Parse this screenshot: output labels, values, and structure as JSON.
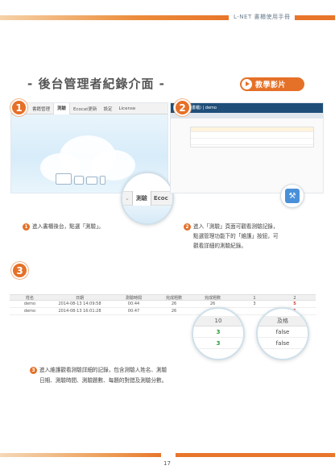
{
  "header": {
    "manual_title": "L-NET 書櫃使用手冊"
  },
  "section": {
    "title": "- 後台管理者紀錄介面 -"
  },
  "video_button": {
    "label": "教學影片"
  },
  "shot1": {
    "badge": "1",
    "nav_items": [
      "書籍管理",
      "測驗",
      "Ecocat更新",
      "設定",
      "License"
    ],
    "zoom_active": "測驗",
    "zoom_next": "Ecoc"
  },
  "shot2": {
    "badge": "2",
    "app_bar": "(書櫃) | demo"
  },
  "captions": {
    "c1_num": "1",
    "c1_text": "進入書櫃後台，點選「測驗」。",
    "c2_num": "2",
    "c2_line1": "進入「測驗」頁面可觀看測驗記錄，",
    "c2_line2": "點選管理功能下的「維護」按鈕，可",
    "c2_line3": "觀看詳細的測驗紀錄。",
    "c3_num": "3",
    "c3_line1": "進入維護觀看測驗詳細的記錄，包含測驗人姓名、測驗",
    "c3_line2": "日期、測驗時間、測驗題數、每題的對錯及測驗分數。"
  },
  "table": {
    "badge": "3",
    "headers": [
      "姓名",
      "日期",
      "測驗時間",
      "完成題數",
      "完成題數",
      "1",
      "2"
    ],
    "rows": [
      [
        "demo",
        "2014-08-13 14:09:58",
        "00:44",
        "26",
        "26",
        "3",
        "5"
      ],
      [
        "demo",
        "2014-08-13 16:01:28",
        "00:47",
        "26",
        "",
        "",
        "5"
      ]
    ]
  },
  "lens_left": {
    "header": "10",
    "rows": [
      "3",
      "3"
    ]
  },
  "lens_right": {
    "header": "及格",
    "rows": [
      "false",
      "false"
    ]
  },
  "footer": {
    "page_number": "17"
  },
  "colors": {
    "accent": "#e57028",
    "nav_blue": "#1f4e79"
  }
}
